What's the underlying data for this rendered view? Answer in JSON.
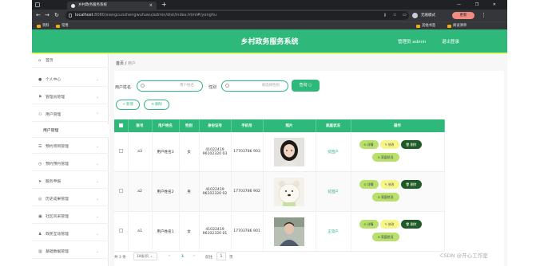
{
  "browser": {
    "tab_title": "乡村政务服务系统",
    "tab_close": "×",
    "new_tab": "+",
    "window_controls": "—  ❐  ✕",
    "url_host": "localhost",
    "url_rest": ":8080/xiangcunzhengwufuwu/admin/dist/index.html#/yonghu",
    "incognito_label": "无痕模式",
    "update_label": "更新",
    "bookmarks": [
      "资料",
      "常用"
    ],
    "bookmarks_right": [
      "其他书签",
      "阅读清单"
    ]
  },
  "header": {
    "title": "乡村政务服务系统",
    "admin_label": "管理员 admin",
    "logout_label": "退出登录"
  },
  "sidebar": {
    "items": [
      {
        "label": "首页",
        "icon": "home-icon"
      },
      {
        "label": "个人中心",
        "icon": "user-icon"
      },
      {
        "label": "管理员管理",
        "icon": "flag-icon"
      },
      {
        "label": "用户管理",
        "icon": "users-icon"
      },
      {
        "label": "用户管理",
        "icon": ""
      },
      {
        "label": "预约项目管理",
        "icon": "list-icon"
      },
      {
        "label": "预约预约管理",
        "icon": "clock-icon"
      },
      {
        "label": "服务申报",
        "icon": "send-icon"
      },
      {
        "label": "历史成果管理",
        "icon": "compass-icon"
      },
      {
        "label": "社区风采管理",
        "icon": "image-icon"
      },
      {
        "label": "政民互动管理",
        "icon": "person-icon"
      },
      {
        "label": "基础数据管理",
        "icon": "chart-icon"
      }
    ]
  },
  "breadcrumb": {
    "home": "首页",
    "sep": "/",
    "current": "用户"
  },
  "search": {
    "name_label": "用户姓名",
    "name_placeholder": "用户姓名",
    "gender_label": "性别",
    "gender_placeholder": "请选择性别",
    "query_button": "查询"
  },
  "actions": {
    "add_button": "+ 新增",
    "delete_button": "删除"
  },
  "table": {
    "columns": [
      "",
      "账号",
      "用户姓名",
      "性别",
      "身份证号",
      "手机号",
      "照片",
      "家庭状况",
      "操作"
    ],
    "rows": [
      {
        "account": "a3",
        "name": "用户姓名3",
        "gender": "女",
        "id_card": "41022419 96102320 03",
        "phone": "17703786 903",
        "status": "贫困户",
        "photo": "photo-woman"
      },
      {
        "account": "a2",
        "name": "用户姓名2",
        "gender": "男",
        "id_card": "41022419 96102320 02",
        "phone": "17703786 902",
        "status": "贫困户",
        "photo": "photo-bear"
      },
      {
        "account": "a1",
        "name": "用户姓名1",
        "gender": "女",
        "id_card": "41022419 96102320 01",
        "phone": "17703786 901",
        "status": "正常户",
        "photo": "photo-man"
      }
    ],
    "op_labels": {
      "detail": "详情",
      "edit": "修改",
      "delete": "删除",
      "review": "家庭状况"
    }
  },
  "pager": {
    "total": "共 3 条",
    "page_size": "10条/页",
    "prev": "‹",
    "page": "1",
    "next": "›",
    "goto_label": "前往",
    "goto_value": "1",
    "page_suffix": "页"
  },
  "watermark": "CSDN @开心工作室",
  "colors": {
    "primary": "#2eb87a",
    "accent_yellow": "#dfff72",
    "danger_dark": "#1f5a27"
  }
}
